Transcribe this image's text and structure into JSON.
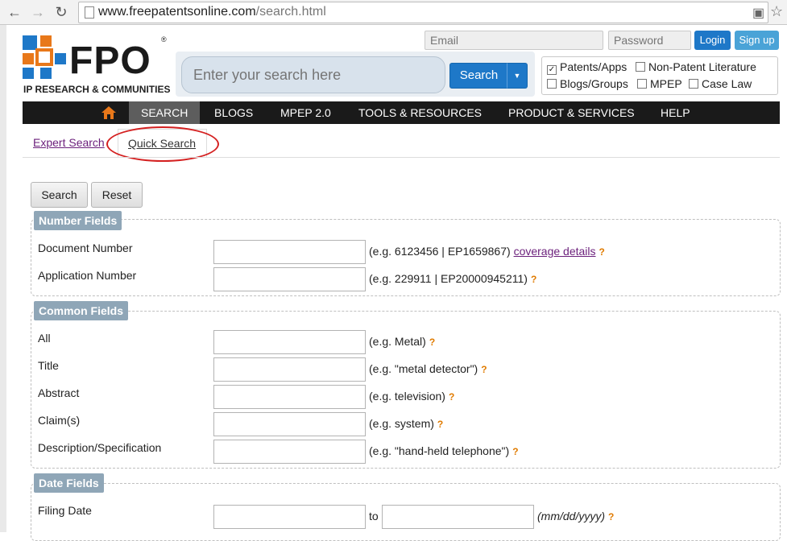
{
  "browser": {
    "url_host": "www.freepatentsonline.com",
    "url_path": "/search.html"
  },
  "header": {
    "logo_text": "FPO",
    "logo_reg": "®",
    "tagline": "IP RESEARCH & COMMUNITIES",
    "search_placeholder": "Enter your search here",
    "search_button": "Search",
    "email_placeholder": "Email",
    "password_placeholder": "Password",
    "login": "Login",
    "signup": "Sign up",
    "filters": [
      {
        "label": "Patents/Apps",
        "checked": true
      },
      {
        "label": "Non-Patent Literature",
        "checked": false
      },
      {
        "label": "Blogs/Groups",
        "checked": false
      },
      {
        "label": "MPEP",
        "checked": false
      },
      {
        "label": "Case Law",
        "checked": false
      }
    ]
  },
  "nav": {
    "items": [
      "SEARCH",
      "BLOGS",
      "MPEP 2.0",
      "TOOLS & RESOURCES",
      "PRODUCT & SERVICES",
      "HELP"
    ],
    "active": "SEARCH"
  },
  "tabs": {
    "expert": "Expert Search",
    "quick": "Quick Search"
  },
  "actions": {
    "search": "Search",
    "reset": "Reset"
  },
  "number_fields": {
    "legend": "Number Fields",
    "rows": [
      {
        "label": "Document Number",
        "hint": "(e.g. 6123456 | EP1659867)",
        "link": "coverage details",
        "help": "?"
      },
      {
        "label": "Application Number",
        "hint": "(e.g. 229911 | EP20000945211)",
        "help": "?"
      }
    ]
  },
  "common_fields": {
    "legend": "Common Fields",
    "rows": [
      {
        "label": "All",
        "hint": "(e.g. Metal)",
        "help": "?"
      },
      {
        "label": "Title",
        "hint": "(e.g. \"metal detector\")",
        "help": "?"
      },
      {
        "label": "Abstract",
        "hint": "(e.g. television)",
        "help": "?"
      },
      {
        "label": "Claim(s)",
        "hint": "(e.g. system)",
        "help": "?"
      },
      {
        "label": "Description/Specification",
        "hint": "(e.g. \"hand-held telephone\")",
        "help": "?"
      }
    ]
  },
  "date_fields": {
    "legend": "Date Fields",
    "rows": [
      {
        "label": "Filing Date",
        "to": "to",
        "format": "(mm/dd/yyyy)",
        "help": "?"
      }
    ]
  },
  "colors": {
    "brand_blue": "#1e78c8",
    "brand_orange": "#e8781a",
    "legend_bg": "#8fa6b7",
    "annotation_red": "#d42020"
  }
}
